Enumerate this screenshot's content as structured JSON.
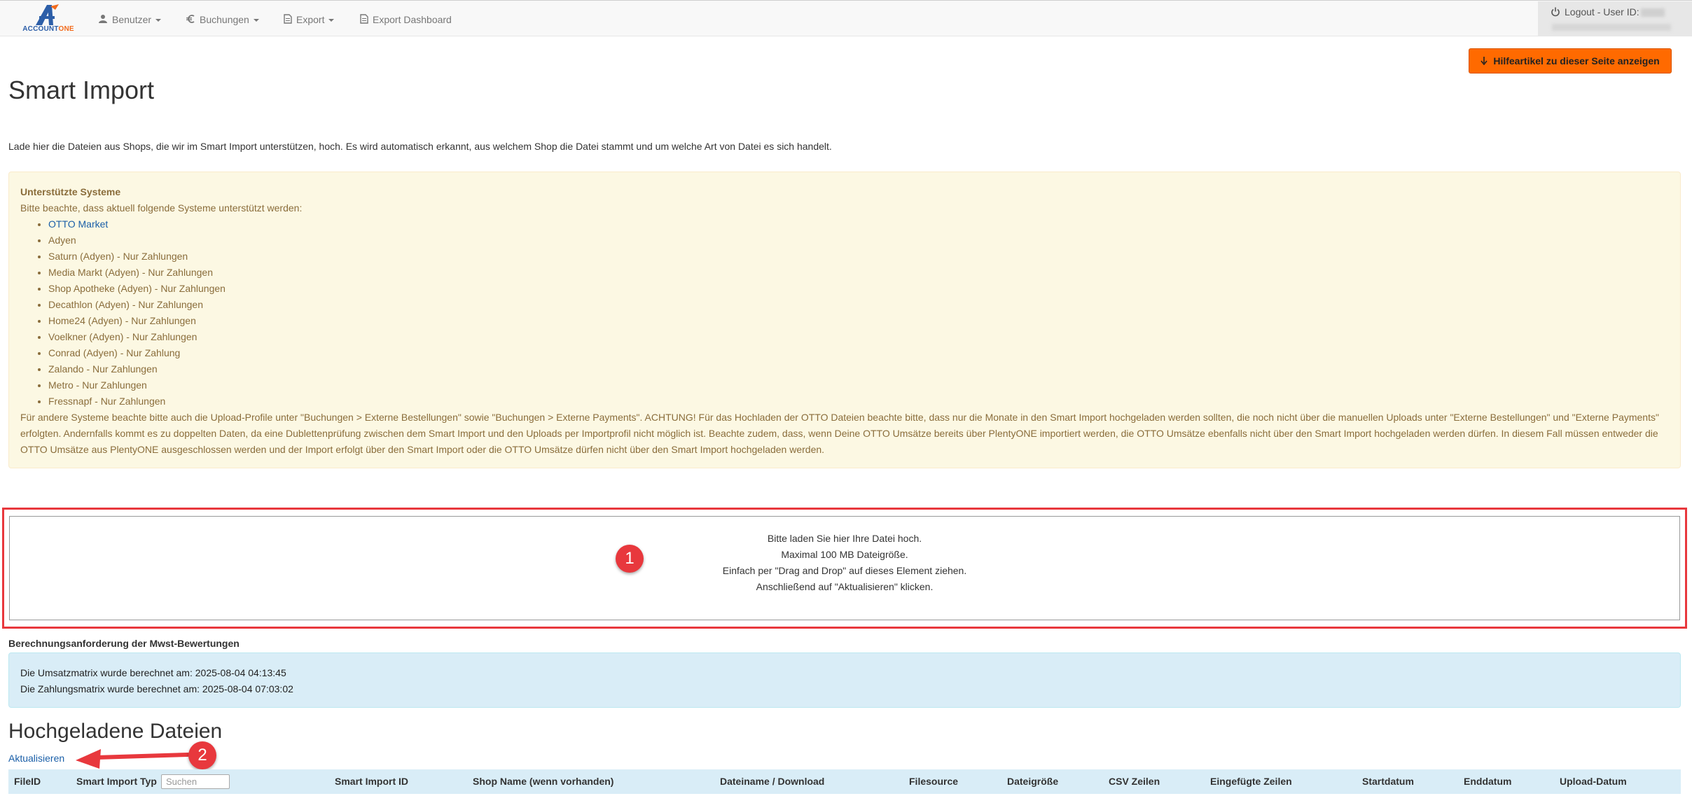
{
  "nav": {
    "logo_a": "ACCOUNT",
    "logo_b": "ONE",
    "items": [
      {
        "label": "Benutzer",
        "icon": "user-icon",
        "dropdown": true
      },
      {
        "label": "Buchungen",
        "icon": "euro-icon",
        "dropdown": true
      },
      {
        "label": "Export",
        "icon": "file-icon",
        "dropdown": true
      },
      {
        "label": "Export Dashboard",
        "icon": "file-icon",
        "dropdown": false
      }
    ],
    "logout": "Logout - User ID:"
  },
  "help_button": "Hilfeartikel zu dieser Seite anzeigen",
  "page_title": "Smart Import",
  "intro": "Lade hier die Dateien aus Shops, die wir im Smart Import unterstützen, hoch. Es wird automatisch erkannt, aus welchem Shop die Datei stammt und um welche Art von Datei es sich handelt.",
  "supported": {
    "title": "Unterstützte Systeme",
    "subtitle": "Bitte beachte, dass aktuell folgende Systeme unterstützt werden:",
    "systems": [
      "OTTO Market",
      "Adyen",
      "Saturn (Adyen) - Nur Zahlungen",
      "Media Markt (Adyen) - Nur Zahlungen",
      "Shop Apotheke (Adyen) - Nur Zahlungen",
      "Decathlon (Adyen) - Nur Zahlungen",
      "Home24 (Adyen) - Nur Zahlungen",
      "Voelkner (Adyen) - Nur Zahlungen",
      "Conrad (Adyen) - Nur Zahlung",
      "Zalando - Nur Zahlungen",
      "Metro - Nur Zahlungen",
      "Fressnapf - Nur Zahlungen"
    ],
    "note": "Für andere Systeme beachte bitte auch die Upload-Profile unter \"Buchungen > Externe Bestellungen\" sowie \"Buchungen > Externe Payments\". ACHTUNG! Für das Hochladen der OTTO Dateien beachte bitte, dass nur die Monate in den Smart Import hochgeladen werden sollten, die noch nicht über die manuellen Uploads unter \"Externe Bestellungen\" und \"Externe Payments\" erfolgten. Andernfalls kommt es zu doppelten Daten, da eine Dublettenprüfung zwischen dem Smart Import und den Uploads per Importprofil nicht möglich ist. Beachte zudem, dass, wenn Deine OTTO Umsätze bereits über PlentyONE importiert werden, die OTTO Umsätze ebenfalls nicht über den Smart Import hochgeladen werden dürfen. In diesem Fall müssen entweder die OTTO Umsätze aus PlentyONE ausgeschlossen werden und der Import erfolgt über den Smart Import oder die OTTO Umsätze dürfen nicht über den Smart Import hochgeladen werden."
  },
  "dropzone": {
    "line1": "Bitte laden Sie hier Ihre Datei hoch.",
    "line2": "Maximal 100 MB Dateigröße.",
    "line3": "Einfach per \"Drag and Drop\" auf dieses Element ziehen.",
    "line4": "Anschließend auf \"Aktualisieren\" klicken."
  },
  "markers": {
    "one": "1",
    "two": "2"
  },
  "calc": {
    "title": "Berechnungsanforderung der Mwst-Bewertungen",
    "line1": "Die Umsatzmatrix wurde berechnet am: 2025-08-04 04:13:45",
    "line2": "Die Zahlungsmatrix wurde berechnet am: 2025-08-04 07:03:02"
  },
  "uploads": {
    "title": "Hochgeladene Dateien",
    "refresh": "Aktualisieren",
    "search_placeholder": "Suchen",
    "columns": [
      "FileID",
      "Smart Import Typ",
      "Smart Import ID",
      "Shop Name (wenn vorhanden)",
      "Dateiname / Download",
      "Filesource",
      "Dateigröße",
      "CSV Zeilen",
      "Eingefügte Zeilen",
      "Startdatum",
      "Enddatum",
      "Upload-Datum"
    ]
  },
  "colors": {
    "accent": "#ff6a00",
    "marker": "#e8383d",
    "link": "#1a5fa8"
  }
}
